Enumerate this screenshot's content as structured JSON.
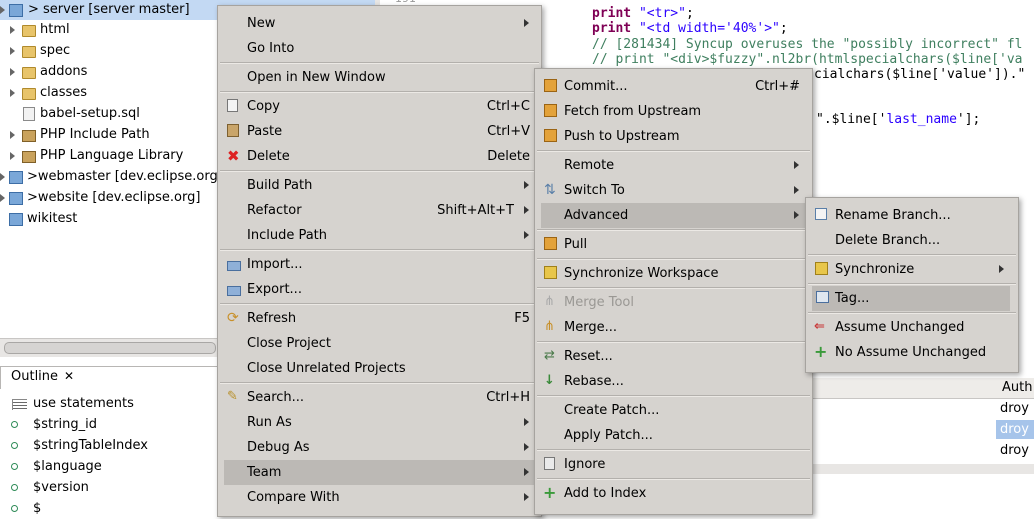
{
  "tree": {
    "items": [
      {
        "label": "> server [server master]",
        "selected": true,
        "icon": "project-icon"
      },
      {
        "label": "html",
        "icon": "folder-icon"
      },
      {
        "label": "spec",
        "icon": "folder-icon"
      },
      {
        "label": "addons",
        "icon": "folder-icon"
      },
      {
        "label": "classes",
        "icon": "folder-icon"
      },
      {
        "label": "babel-setup.sql",
        "icon": "file-icon"
      },
      {
        "label": "PHP Include Path",
        "icon": "library-icon"
      },
      {
        "label": "PHP Language Library",
        "icon": "library-icon"
      },
      {
        "label": ">webmaster   [dev.eclipse.org]",
        "icon": "project-icon"
      },
      {
        "label": ">website   [dev.eclipse.org]",
        "icon": "project-icon"
      },
      {
        "label": "wikitest",
        "icon": "project-icon"
      }
    ],
    "partial_number": "191"
  },
  "outline": {
    "tab_label": "Outline",
    "items": [
      "use statements",
      "$string_id",
      "$stringTableIndex",
      "$language",
      "$version",
      "$"
    ]
  },
  "editor": {
    "lines": [
      {
        "text_kw": "print ",
        "text_str": "\"<tr>\"",
        "text_rest": ";"
      },
      {
        "text_kw": "print ",
        "text_str": "\"<td width='40%'>\"",
        "text_rest": ";"
      },
      {
        "comment": "// [281434] Syncup overuses the \"possibly incorrect\" fl"
      },
      {
        "comment": "// print \"<div>$fuzzy\".nl2br(htmlspecialchars($line['va"
      },
      {
        "plain": "cialchars($line['value']).\""
      },
      {
        "plain1": "\".$line['",
        "str": "last_name",
        "plain2": "'];"
      }
    ]
  },
  "table": {
    "header": "Auth",
    "rows": [
      "droy",
      "droy",
      "droy"
    ]
  },
  "context_menu": {
    "items": [
      {
        "label": "New",
        "submenu": true
      },
      {
        "label": "Go Into"
      },
      {
        "label": "Open in New Window"
      },
      {
        "label": "Copy",
        "shortcut": "Ctrl+C",
        "icon": "copy-icon"
      },
      {
        "label": "Paste",
        "shortcut": "Ctrl+V",
        "icon": "paste-icon"
      },
      {
        "label": "Delete",
        "shortcut": "Delete",
        "icon": "delete-icon"
      },
      {
        "label": "Build Path",
        "submenu": true
      },
      {
        "label": "Refactor",
        "shortcut": "Shift+Alt+T",
        "submenu": true
      },
      {
        "label": "Include Path",
        "submenu": true
      },
      {
        "label": "Import...",
        "icon": "import-icon"
      },
      {
        "label": "Export...",
        "icon": "export-icon"
      },
      {
        "label": "Refresh",
        "shortcut": "F5",
        "icon": "refresh-icon"
      },
      {
        "label": "Close Project"
      },
      {
        "label": "Close Unrelated Projects"
      },
      {
        "label": "Search...",
        "shortcut": "Ctrl+H",
        "icon": "search-icon"
      },
      {
        "label": "Run As",
        "submenu": true
      },
      {
        "label": "Debug As",
        "submenu": true
      },
      {
        "label": "Team",
        "submenu": true,
        "highlighted": true
      },
      {
        "label": "Compare With",
        "submenu": true
      }
    ]
  },
  "team_menu": {
    "items": [
      {
        "label": "Commit...",
        "shortcut": "Ctrl+#",
        "icon": "commit-icon"
      },
      {
        "label": "Fetch from Upstream",
        "icon": "fetch-icon"
      },
      {
        "label": "Push to Upstream",
        "icon": "push-icon"
      },
      {
        "label": "Remote",
        "submenu": true
      },
      {
        "label": "Switch To",
        "submenu": true,
        "icon": "switch-icon"
      },
      {
        "label": "Advanced",
        "submenu": true,
        "highlighted": true
      },
      {
        "label": "Pull",
        "icon": "pull-icon"
      },
      {
        "label": "Synchronize Workspace",
        "icon": "synchronize-icon"
      },
      {
        "label": "Merge Tool",
        "disabled": true,
        "icon": "merge-tool-icon"
      },
      {
        "label": "Merge...",
        "icon": "merge-icon"
      },
      {
        "label": "Reset...",
        "icon": "reset-icon"
      },
      {
        "label": "Rebase...",
        "icon": "rebase-icon"
      },
      {
        "label": "Create Patch..."
      },
      {
        "label": "Apply Patch..."
      },
      {
        "label": "Ignore",
        "icon": "ignore-icon"
      },
      {
        "label": "Add to Index",
        "icon": "add-icon"
      }
    ]
  },
  "advanced_menu": {
    "items": [
      {
        "label": "Rename Branch...",
        "icon": "rename-icon"
      },
      {
        "label": "Delete Branch..."
      },
      {
        "label": "Synchronize",
        "submenu": true,
        "icon": "synchronize-icon"
      },
      {
        "label": "Tag...",
        "highlighted": true,
        "icon": "tag-icon"
      },
      {
        "label": "Assume Unchanged",
        "icon": "assume-unchanged-icon"
      },
      {
        "label": "No Assume Unchanged",
        "icon": "no-assume-unchanged-icon"
      }
    ]
  },
  "colors": {
    "selection": "#c3d9f3",
    "menu_bg": "#d6d3cf",
    "menu_highlight": "#bcb9b5",
    "keyword": "#7f0055",
    "string": "#2a00ff",
    "comment": "#3f7f5f"
  }
}
